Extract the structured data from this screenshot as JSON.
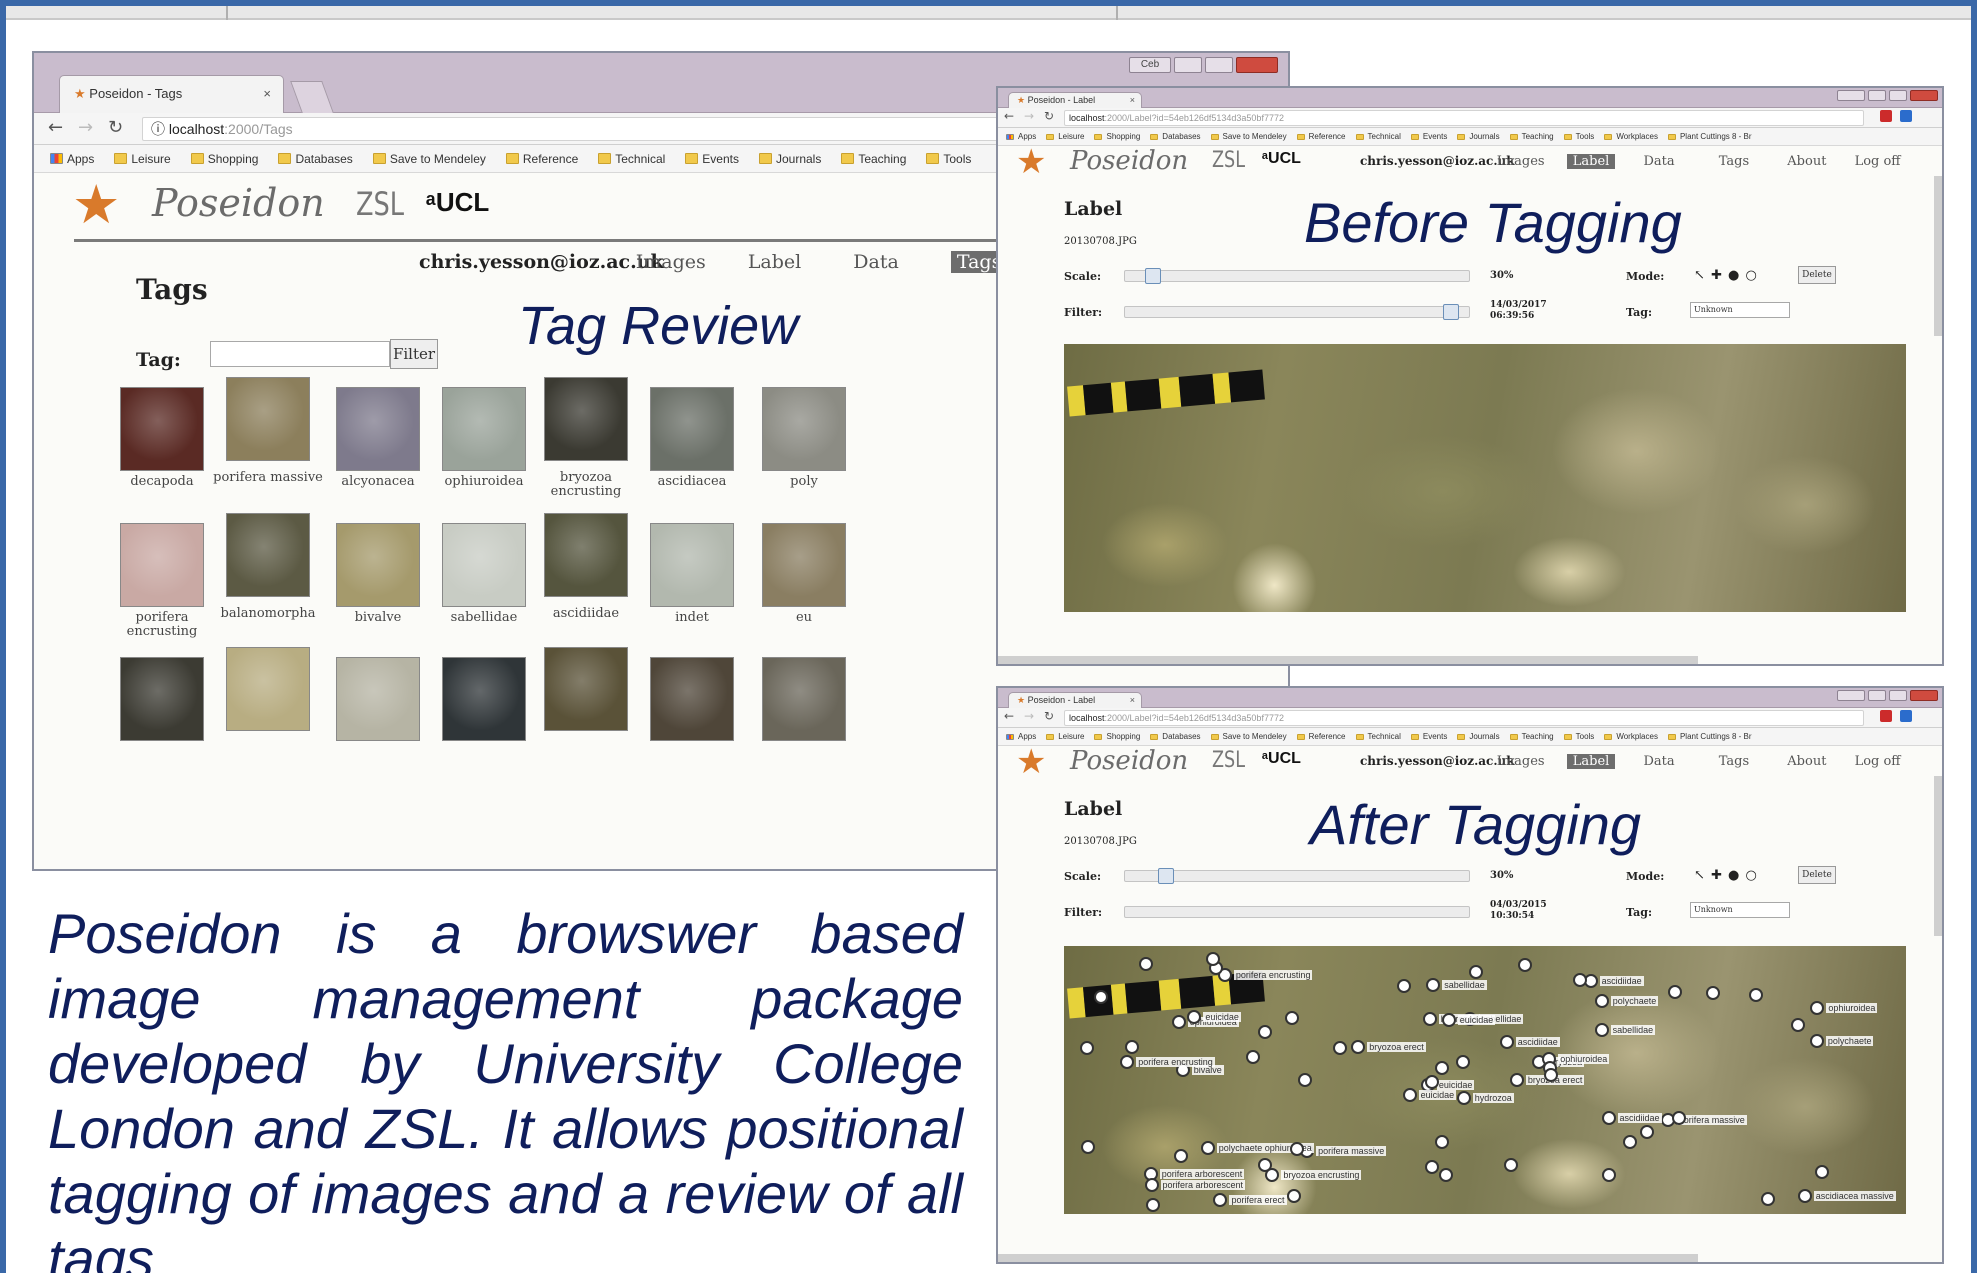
{
  "tag_window": {
    "tab_title": "Poseidon - Tags",
    "window_button_label": "Ceb",
    "url_host": "localhost",
    "url_path": ":2000/Tags",
    "bookmarks": [
      "Apps",
      "Leisure",
      "Shopping",
      "Databases",
      "Save to Mendeley",
      "Reference",
      "Technical",
      "Events",
      "Journals",
      "Teaching",
      "Tools"
    ],
    "logo_text": "Poseidon",
    "zsl_text": "ZSL",
    "ucl_text": "ᵃUCL",
    "nav": {
      "user": "chris.yesson@ioz.ac.uk",
      "images": "Images",
      "label": "Label",
      "data": "Data",
      "tags": "Tags"
    },
    "heading": "Tags",
    "tag_field_label": "Tag:",
    "filter_button": "Filter",
    "overlay_title": "Tag Review",
    "thumbnails": [
      {
        "label": "decapoda",
        "color": "#5a2a24"
      },
      {
        "label": "porifera massive",
        "color": "#8c7f5c"
      },
      {
        "label": "alcyonacea",
        "color": "#7e7a8c"
      },
      {
        "label": "ophiuroidea",
        "color": "#9aa39a"
      },
      {
        "label": "bryozoa encrusting",
        "color": "#3b3a32"
      },
      {
        "label": "ascidiacea",
        "color": "#6b7068"
      },
      {
        "label": "poly",
        "color": "#8c8c84"
      },
      {
        "label": "porifera encrusting",
        "color": "#c9a9a4"
      },
      {
        "label": "balanomorpha",
        "color": "#5c5a44"
      },
      {
        "label": "bivalve",
        "color": "#a59a6c"
      },
      {
        "label": "sabellidae",
        "color": "#c8ccc4"
      },
      {
        "label": "ascidiidae",
        "color": "#55553e"
      },
      {
        "label": "indet",
        "color": "#b2b8ae"
      },
      {
        "label": "eu",
        "color": "#8a7e62"
      },
      {
        "label": "",
        "color": "#3c3b33"
      },
      {
        "label": "",
        "color": "#b8ad82"
      },
      {
        "label": "",
        "color": "#b6b4a4"
      },
      {
        "label": "",
        "color": "#2f3538"
      },
      {
        "label": "",
        "color": "#5a5238"
      },
      {
        "label": "",
        "color": "#4f4639"
      },
      {
        "label": "",
        "color": "#6a665a"
      }
    ]
  },
  "before_window": {
    "tab_title": "Poseidon - Label",
    "url_host": "localhost",
    "url_path": ":2000/Label?id=54eb126df5134d3a50bf7772",
    "bookmarks": [
      "Apps",
      "Leisure",
      "Shopping",
      "Databases",
      "Save to Mendeley",
      "Reference",
      "Technical",
      "Events",
      "Journals",
      "Teaching",
      "Tools",
      "Workplaces",
      "Plant Cuttings 8 - Br"
    ],
    "logo_text": "Poseidon",
    "zsl_text": "ZSL",
    "ucl_text": "ᵃUCL",
    "nav": {
      "user": "chris.yesson@ioz.ac.uk",
      "images": "Images",
      "label": "Label",
      "data": "Data",
      "tags": "Tags",
      "about": "About",
      "logoff": "Log off"
    },
    "heading": "Label",
    "filename": "20130708.JPG",
    "scale_label": "Scale:",
    "scale_value": "30%",
    "filter_label": "Filter:",
    "date": "14/03/2017",
    "time": "06:39:56",
    "mode_label": "Mode:",
    "mode_icons": "↖ ✚ ● ○",
    "delete_button": "Delete",
    "tag_label": "Tag:",
    "tag_value": "Unknown",
    "overlay_title": "Before Tagging",
    "scale_level": 0.06,
    "filter_level": 0.97
  },
  "after_window": {
    "tab_title": "Poseidon - Label",
    "url_host": "localhost",
    "url_path": ":2000/Label?id=54eb126df5134d3a50bf7772",
    "bookmarks": [
      "Apps",
      "Leisure",
      "Shopping",
      "Databases",
      "Save to Mendeley",
      "Reference",
      "Technical",
      "Events",
      "Journals",
      "Teaching",
      "Tools",
      "Workplaces",
      "Plant Cuttings 8 - Br"
    ],
    "logo_text": "Poseidon",
    "zsl_text": "ZSL",
    "ucl_text": "ᵃUCL",
    "nav": {
      "user": "chris.yesson@ioz.ac.uk",
      "images": "Images",
      "label": "Label",
      "data": "Data",
      "tags": "Tags",
      "about": "About",
      "logoff": "Log off"
    },
    "heading": "Label",
    "filename": "20130708.JPG",
    "scale_label": "Scale:",
    "scale_value": "30%",
    "filter_label": "Filter:",
    "date": "04/03/2015",
    "time": "10:30:54",
    "mode_label": "Mode:",
    "mode_icons": "↖ ✚ ● ○",
    "delete_button": "Delete",
    "tag_label": "Tag:",
    "tag_value": "Unknown",
    "overlay_title": "After Tagging",
    "scale_level": 0.1,
    "tags": [
      "hydrozoa",
      "ophiuroidea",
      "euicidae",
      "porifera arborescent",
      "bryozoa",
      "porifera massive",
      "ascidiidae",
      "sabellidae",
      "polychaete",
      "bryozoa erect",
      "porifera encrusting",
      "ascidiacea massive",
      "bivalve",
      "ophiuroidea",
      "euicidae",
      "sabellidae",
      "porifera erect",
      "hydrozoa",
      "ascidiidae",
      "polychaete ophiuroidea",
      "bryozoa erect",
      "porifera arborescent",
      "bryozoa encrusting",
      "euicidae",
      "ophiuroidea",
      "porifera massive",
      "euicidae",
      "sabellidae",
      "porifera encrusting",
      "ascidiidae",
      "polychaete"
    ]
  },
  "description": "Poseidon is a browswer based image management package developed by University College London and ZSL. It allows positional tagging of images and a review of all tags"
}
